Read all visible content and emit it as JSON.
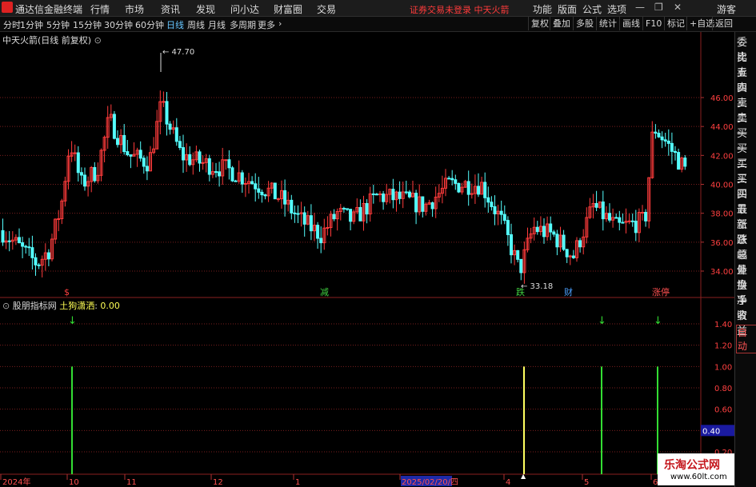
{
  "app": {
    "title": "通达信金融终端",
    "warning": "证券交易未登录  中天火箭"
  },
  "menu": [
    "行情",
    "市场",
    "资讯",
    "发现",
    "问小达",
    "财富圈",
    "交易"
  ],
  "right_menu": [
    "功能",
    "版面",
    "公式",
    "选项",
    "游客"
  ],
  "periods": [
    "分时",
    "1分钟",
    "5分钟",
    "15分钟",
    "30分钟",
    "60分钟",
    "日线",
    "周线",
    "月线",
    "多周期",
    "更多"
  ],
  "active_period": "日线",
  "tools": [
    "复权",
    "叠加",
    "多股",
    "统计",
    "画线",
    "F10",
    "标记",
    "+自选",
    "返回"
  ],
  "stock": {
    "name": "中天火箭(日线 前复权)"
  },
  "indicator": {
    "name": "股朋指标网",
    "line": "土狗潇洒",
    "value": "0.00"
  },
  "price_axis": [
    "46.00",
    "44.00",
    "42.00",
    "40.00",
    "38.00",
    "36.00",
    "34.00"
  ],
  "ind_axis": [
    "1.40",
    "1.20",
    "1.00",
    "0.80",
    "0.60",
    "0.40",
    "0.20"
  ],
  "ind_current": "0.40",
  "annotations": {
    "high": "47.70",
    "low": "33.18"
  },
  "markers": [
    {
      "label": "$",
      "color": "#ff4040"
    },
    {
      "label": "减",
      "color": "#40d040"
    },
    {
      "label": "跌",
      "color": "#40d040"
    },
    {
      "label": "财",
      "color": "#4aa0ff"
    },
    {
      "label": "涨停",
      "color": "#ff5050"
    }
  ],
  "time_axis": [
    "2024年",
    "10",
    "11",
    "12",
    "1",
    "2025/02/20/四",
    "4",
    "5",
    "6"
  ],
  "side_items": [
    "委比",
    "卖五",
    "卖四",
    "卖三",
    "卖二",
    "卖一",
    "买一",
    "买二",
    "买三",
    "买四",
    "买五",
    "最新",
    "涨跌",
    "涨幅",
    "总量",
    "外盘",
    "换手",
    "净资",
    "收益",
    "自动"
  ],
  "watermark": {
    "cn": "乐淘公式网",
    "url": "www.60lt.com"
  },
  "colors": {
    "up": "#ff3b3b",
    "down": "#54ffff",
    "grid": "#7a1e1e",
    "signal_green": "#33dd33",
    "signal_yellow": "#ffff60"
  }
}
